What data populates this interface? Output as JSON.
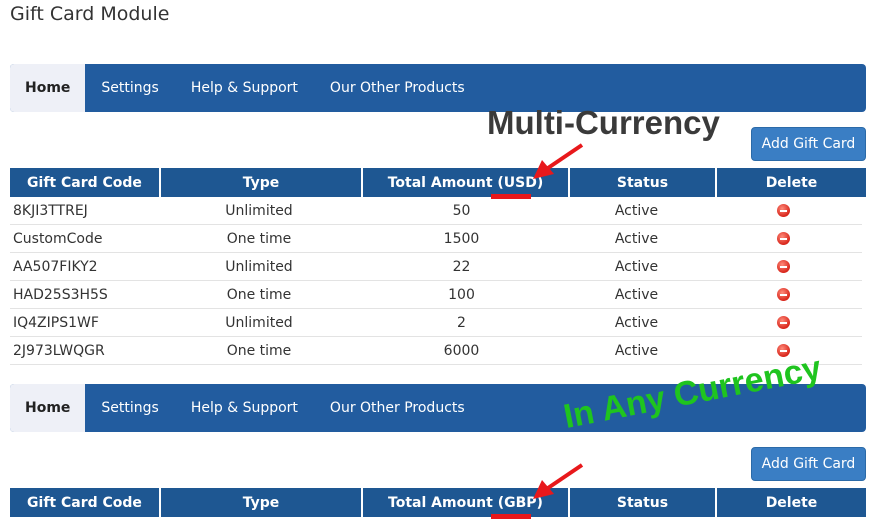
{
  "page": {
    "title": "Gift Card Module"
  },
  "nav": {
    "items": [
      {
        "label": "Home"
      },
      {
        "label": "Settings"
      },
      {
        "label": "Help & Support"
      },
      {
        "label": "Our Other Products"
      }
    ]
  },
  "actions": {
    "add_label": "Add Gift Card"
  },
  "table1": {
    "headers": [
      "Gift Card Code",
      "Type",
      "Total Amount (USD)",
      "Status",
      "Delete"
    ],
    "rows": [
      {
        "code": "8KJI3TTREJ",
        "type": "Unlimited",
        "amount": "50",
        "status": "Active"
      },
      {
        "code": "CustomCode",
        "type": "One time",
        "amount": "1500",
        "status": "Active"
      },
      {
        "code": "AA507FIKY2",
        "type": "Unlimited",
        "amount": "22",
        "status": "Active"
      },
      {
        "code": "HAD25S3H5S",
        "type": "One time",
        "amount": "100",
        "status": "Active"
      },
      {
        "code": "IQ4ZIPS1WF",
        "type": "Unlimited",
        "amount": "2",
        "status": "Active"
      },
      {
        "code": "2J973LWQGR",
        "type": "One time",
        "amount": "6000",
        "status": "Active"
      }
    ]
  },
  "table2": {
    "headers": [
      "Gift Card Code",
      "Type",
      "Total Amount (GBP)",
      "Status",
      "Delete"
    ]
  },
  "annotations": {
    "multi_currency": "Multi-Currency",
    "any_currency": "In Any Currency",
    "arrow_color": "#e8181b",
    "any_currency_color": "#1fc41f"
  },
  "colors": {
    "nav_bg": "#225c9f",
    "header_bg": "#1e5792",
    "button_bg": "#3a7ec4"
  }
}
